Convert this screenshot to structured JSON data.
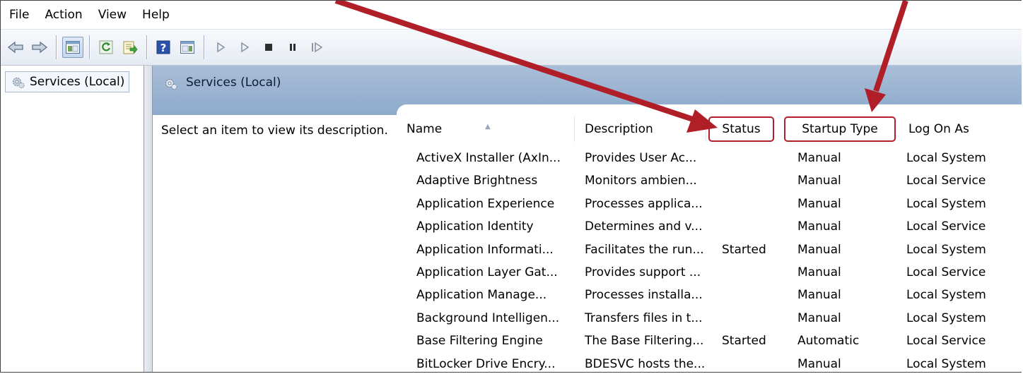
{
  "menu": [
    "File",
    "Action",
    "View",
    "Help"
  ],
  "tree": {
    "root_label": "Services (Local)"
  },
  "panel": {
    "title": "Services (Local)",
    "description_hint": "Select an item to view its description."
  },
  "columns": [
    "Name",
    "Description",
    "Status",
    "Startup Type",
    "Log On As"
  ],
  "rows": [
    {
      "name": "ActiveX Installer (AxIn...",
      "description": "Provides User Ac...",
      "status": "",
      "startup": "Manual",
      "logon": "Local System"
    },
    {
      "name": "Adaptive Brightness",
      "description": "Monitors ambien...",
      "status": "",
      "startup": "Manual",
      "logon": "Local Service"
    },
    {
      "name": "Application Experience",
      "description": "Processes applica...",
      "status": "",
      "startup": "Manual",
      "logon": "Local System"
    },
    {
      "name": "Application Identity",
      "description": "Determines and v...",
      "status": "",
      "startup": "Manual",
      "logon": "Local Service"
    },
    {
      "name": "Application Informati...",
      "description": "Facilitates the run...",
      "status": "Started",
      "startup": "Manual",
      "logon": "Local System"
    },
    {
      "name": "Application Layer Gat...",
      "description": "Provides support ...",
      "status": "",
      "startup": "Manual",
      "logon": "Local Service"
    },
    {
      "name": "Application Manage...",
      "description": "Processes installa...",
      "status": "",
      "startup": "Manual",
      "logon": "Local System"
    },
    {
      "name": "Background Intelligen...",
      "description": "Transfers files in t...",
      "status": "",
      "startup": "Manual",
      "logon": "Local System"
    },
    {
      "name": "Base Filtering Engine",
      "description": "The Base Filtering...",
      "status": "Started",
      "startup": "Automatic",
      "logon": "Local Service"
    },
    {
      "name": "BitLocker Drive Encry...",
      "description": "BDESVC hosts the...",
      "status": "",
      "startup": "Manual",
      "logon": "Local System"
    }
  ],
  "annotation": {
    "color": "#b01e28"
  }
}
